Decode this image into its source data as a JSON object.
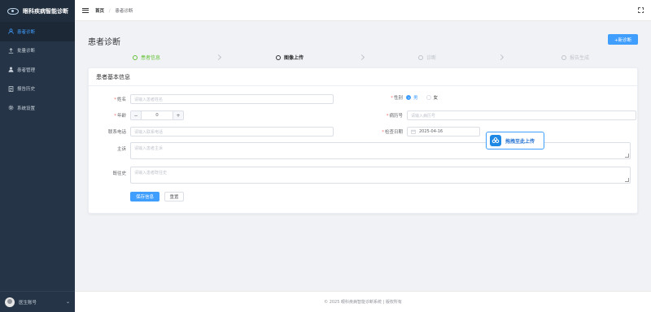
{
  "app": {
    "title": "眼科疾病智能诊断"
  },
  "sidebar": {
    "items": [
      {
        "label": "患者诊断",
        "icon": "user-icon"
      },
      {
        "label": "批量诊断",
        "icon": "upload-icon"
      },
      {
        "label": "患者管理",
        "icon": "users-icon"
      },
      {
        "label": "报告历史",
        "icon": "document-icon"
      },
      {
        "label": "系统设置",
        "icon": "gear-icon"
      }
    ],
    "account_label": "医生账号"
  },
  "header": {
    "breadcrumb_home": "首页",
    "breadcrumb_sep": "/",
    "breadcrumb_current": "患者诊断"
  },
  "main": {
    "title": "患者诊断",
    "new_button": "+新诊断",
    "steps": [
      {
        "label": "患者信息",
        "state": "done"
      },
      {
        "label": "图像上传",
        "state": "current"
      },
      {
        "label": "诊断",
        "state": "pending"
      },
      {
        "label": "报告生成",
        "state": "pending"
      }
    ]
  },
  "form": {
    "title": "患者基本信息",
    "name_label": "姓名",
    "name_placeholder": "请输入患者姓名",
    "gender_label": "性别",
    "gender_male": "男",
    "gender_female": "女",
    "age_label": "年龄",
    "age_value": "0",
    "minus": "−",
    "plus": "+",
    "record_label": "病历号",
    "record_placeholder": "请输入病历号",
    "phone_label": "联系电话",
    "phone_placeholder": "请输入联系电话",
    "date_label": "检查日期",
    "date_value": "2025-04-16",
    "complaint_label": "主诉",
    "complaint_placeholder": "请输入患者主诉",
    "history_label": "既往史",
    "history_placeholder": "请输入患者既往史",
    "save_button": "保存信息",
    "reset_button": "重置",
    "required_mark": "*"
  },
  "drag_upload": {
    "label": "拖拽至此上传"
  },
  "footer": {
    "text": "© 2025 眼科疾病智能诊断系统 | 版权所有"
  },
  "colors": {
    "primary": "#409eff",
    "sidebar": "#253547",
    "success": "#67c23a"
  }
}
